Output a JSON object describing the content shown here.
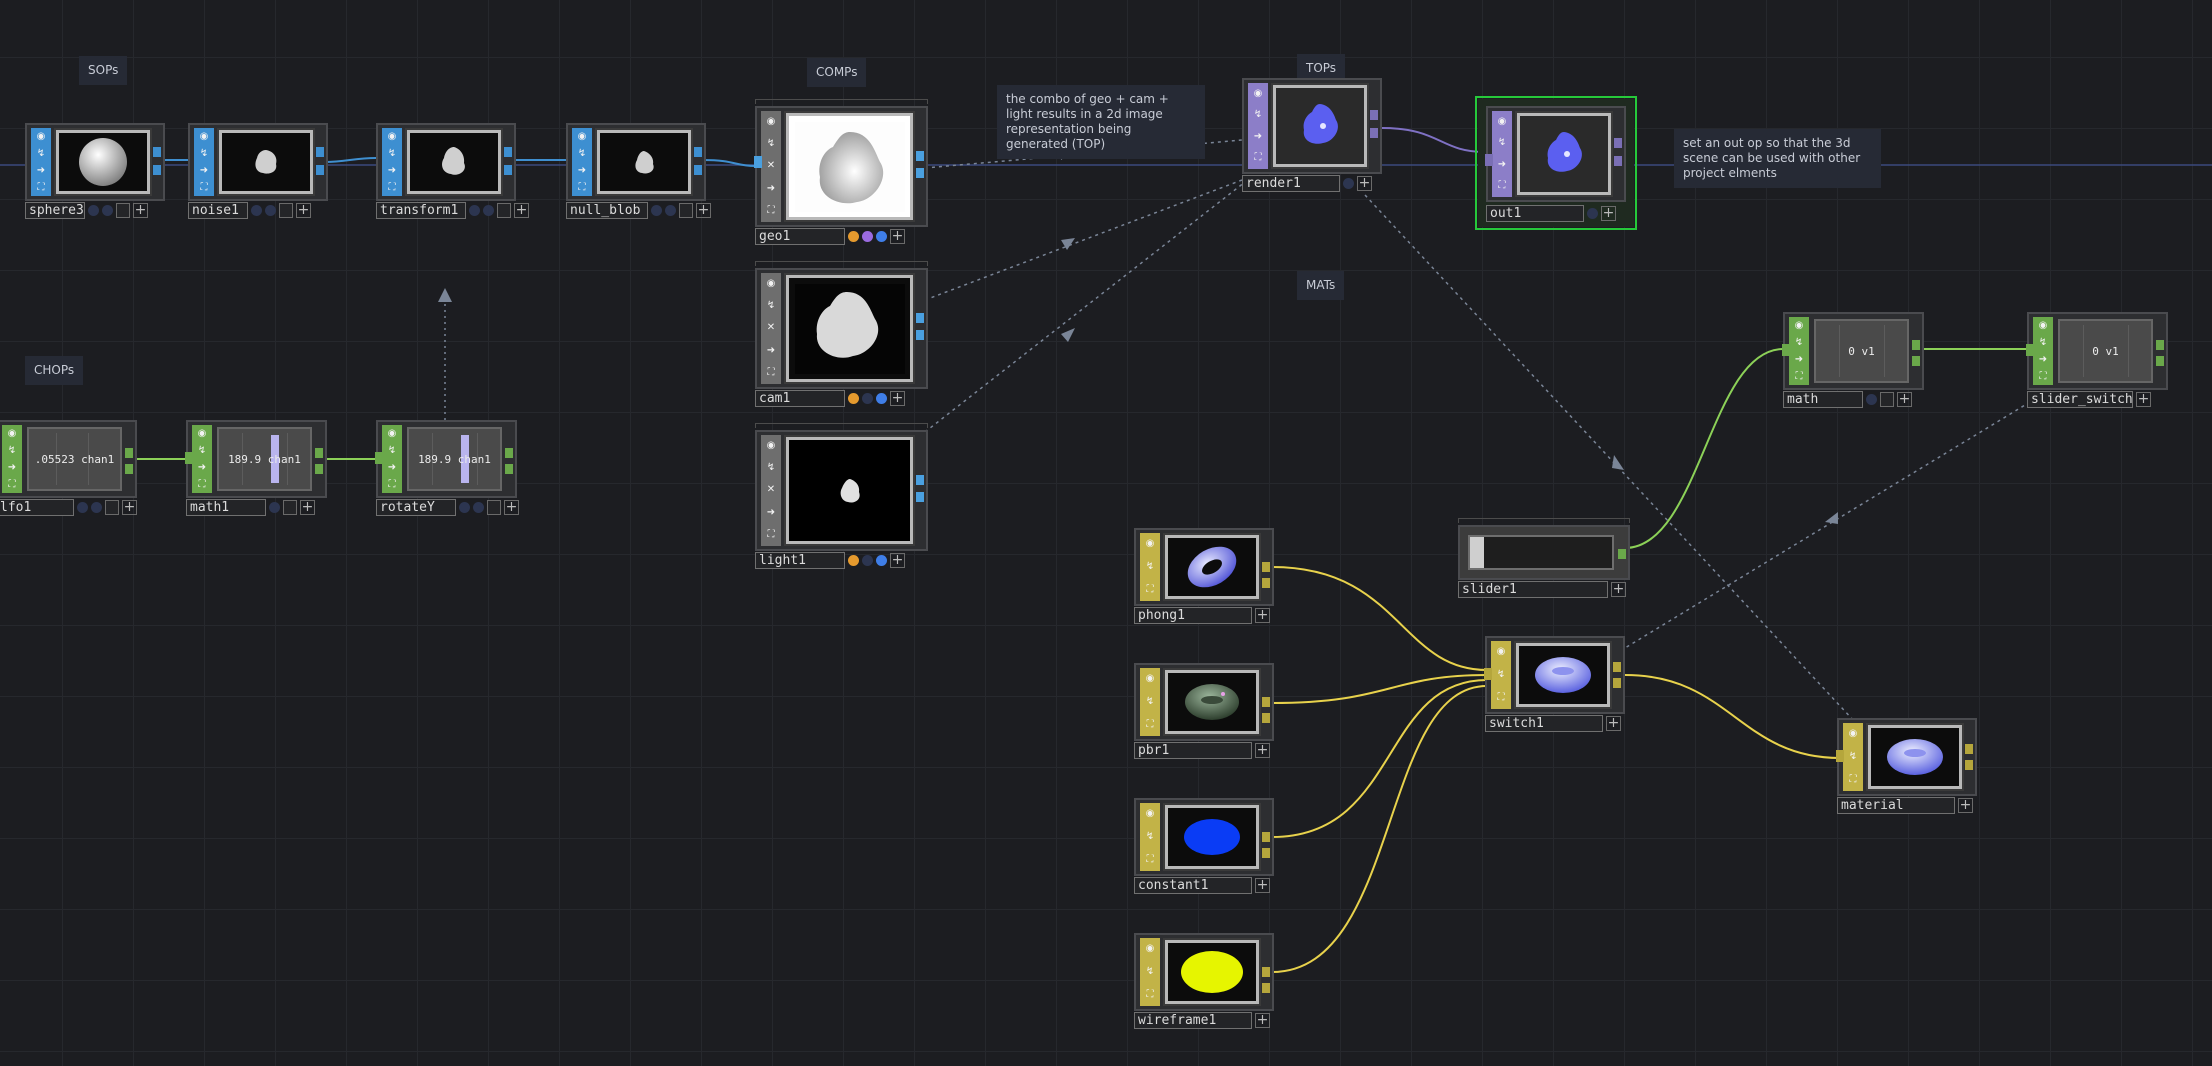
{
  "family_labels": {
    "sops": "SOPs",
    "comps": "COMPs",
    "tops": "TOPs",
    "mats": "MATs",
    "chops": "CHOPs"
  },
  "comments": {
    "render_note": "the combo of geo + cam + light results in a 2d image representation being generated (TOP)",
    "out_note": "set an out op so that the 3d scene can be used with other project elments"
  },
  "nodes": {
    "sphere3": {
      "name": "sphere3"
    },
    "noise1": {
      "name": "noise1"
    },
    "transform1": {
      "name": "transform1"
    },
    "null_blob": {
      "name": "null_blob"
    },
    "geo1": {
      "name": "geo1"
    },
    "cam1": {
      "name": "cam1"
    },
    "light1": {
      "name": "light1"
    },
    "render1": {
      "name": "render1"
    },
    "out1": {
      "name": "out1"
    },
    "lfo1": {
      "name": "lfo1",
      "value": ".05523 chan1"
    },
    "math1": {
      "name": "math1",
      "value": "189.9 chan1"
    },
    "rotateY": {
      "name": "rotateY",
      "value": "189.9 chan1"
    },
    "math": {
      "name": "math",
      "value": "0 v1"
    },
    "slider_switch": {
      "name": "slider_switch",
      "value": "0 v1"
    },
    "slider1": {
      "name": "slider1"
    },
    "phong1": {
      "name": "phong1"
    },
    "pbr1": {
      "name": "pbr1"
    },
    "constant1": {
      "name": "constant1"
    },
    "wireframe1": {
      "name": "wireframe1"
    },
    "switch1": {
      "name": "switch1"
    },
    "material": {
      "name": "material"
    }
  },
  "colors": {
    "sop": "#3d8fd1",
    "top": "#8c7ec8",
    "mat": "#c2b347",
    "chop": "#6aa84a",
    "comp": "#6e6e6e",
    "canvas": "#1c1d21",
    "selected_outline": "#26c93a",
    "wire_sop": "#3f8fd0",
    "wire_top": "#7f71c4",
    "wire_chop": "#8cd158",
    "wire_mat": "#e8d24c",
    "wire_dashed": "#7a8597"
  },
  "icons": [
    "viewer-icon",
    "bypass-icon",
    "lock-icon",
    "cook-icon",
    "close-icon",
    "add-icon"
  ]
}
